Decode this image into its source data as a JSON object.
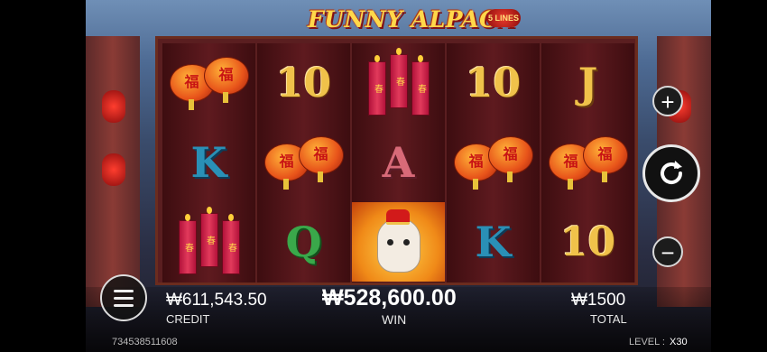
{
  "game": {
    "title": "FUNNY ALPACA",
    "lines_badge": "5 LINES"
  },
  "reels": [
    [
      "lantern",
      "K",
      "firecracker"
    ],
    [
      "10",
      "lantern",
      "Q"
    ],
    [
      "firecracker",
      "A",
      "alpaca"
    ],
    [
      "10",
      "lantern",
      "K"
    ],
    [
      "J",
      "lantern",
      "10"
    ]
  ],
  "symbols": {
    "lantern_char": "福",
    "firecracker_char": "春",
    "num10": "10",
    "k": "K",
    "q": "Q",
    "a": "A",
    "j": "J"
  },
  "hud": {
    "credit_value": "₩611,543.50",
    "credit_label": "CREDIT",
    "win_value": "₩528,600.00",
    "win_label": "WIN",
    "total_value": "₩1500",
    "total_label": "TOTAL",
    "session_id": "734538511608",
    "level_label": "LEVEL :",
    "level_value": "X30"
  },
  "buttons": {
    "plus": "+",
    "minus": "−"
  },
  "colors": {
    "reel_bg": "#5e1a1f",
    "gold": "#f0c24a"
  }
}
